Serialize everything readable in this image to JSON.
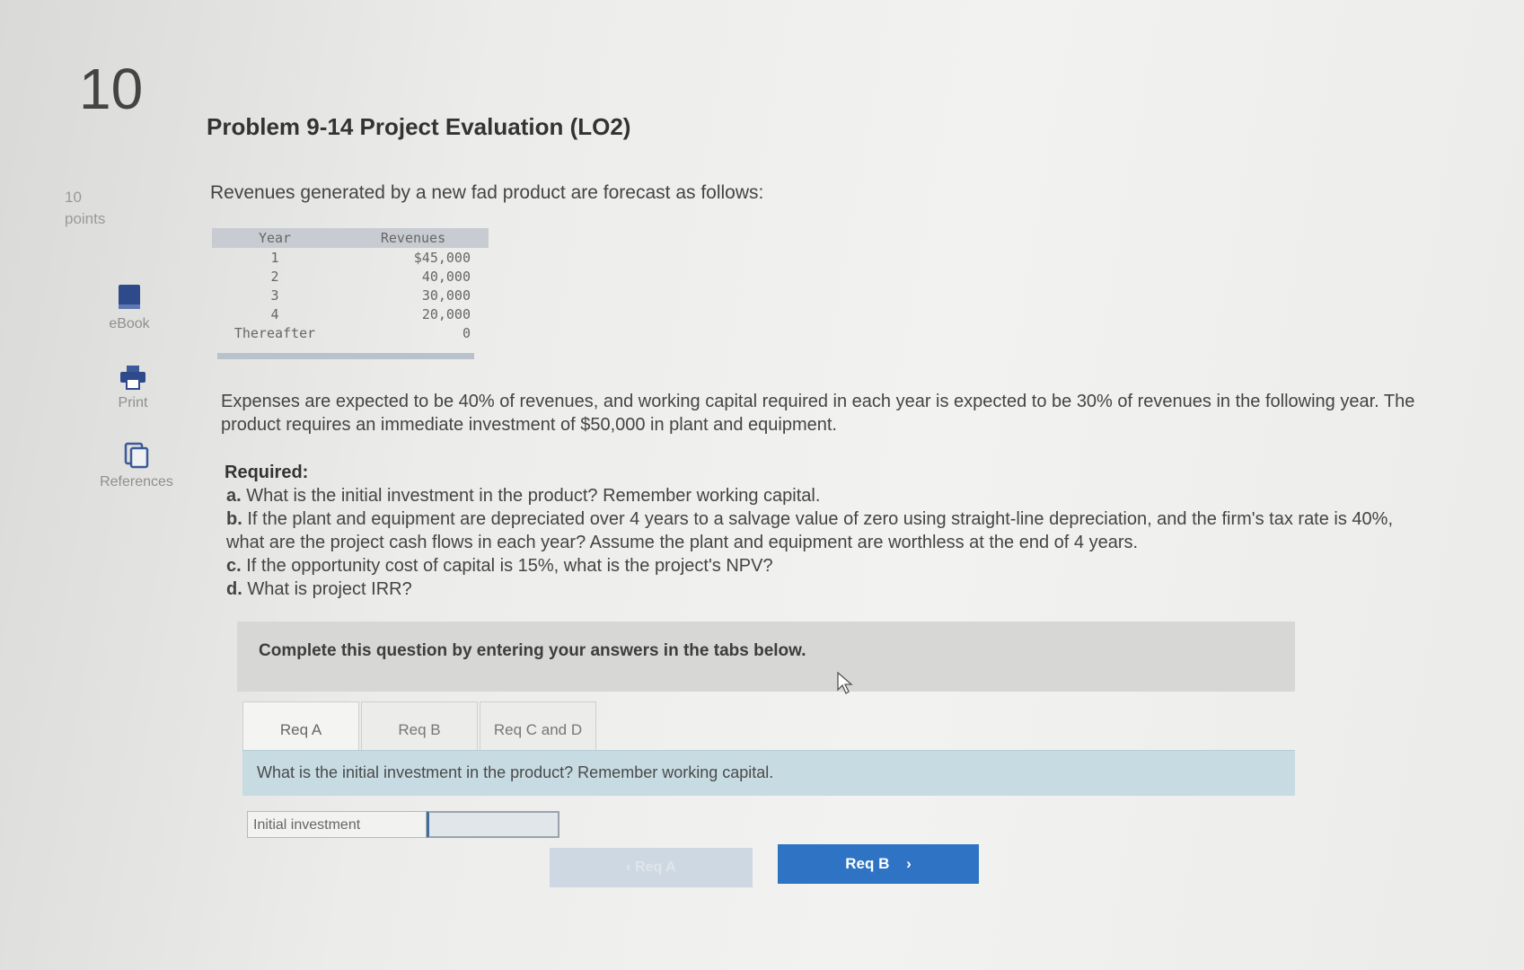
{
  "question": {
    "number": "10",
    "points_value": "10",
    "points_label": "points"
  },
  "tools": {
    "ebook": "eBook",
    "print": "Print",
    "references": "References"
  },
  "problem": {
    "title": "Problem 9-14 Project Evaluation (LO2)",
    "intro": "Revenues generated by a new fad product are forecast as follows:",
    "table": {
      "headers": [
        "Year",
        "Revenues"
      ],
      "rows": [
        [
          "1",
          "$45,000"
        ],
        [
          "2",
          "40,000"
        ],
        [
          "3",
          "30,000"
        ],
        [
          "4",
          "20,000"
        ],
        [
          "Thereafter",
          "0"
        ]
      ]
    },
    "paragraph": "Expenses are expected to be 40% of revenues, and working capital required in each year is expected to be 30% of revenues in the following year. The product requires an immediate investment of $50,000 in plant and equipment.",
    "required": {
      "heading": "Required:",
      "items": [
        {
          "letter": "a.",
          "text": "What is the initial investment in the product? Remember working capital."
        },
        {
          "letter": "b.",
          "text": "If the plant and equipment are depreciated over 4 years to a salvage value of zero using straight-line depreciation, and the firm's tax rate is 40%, what are the project cash flows in each year? Assume the plant  and equipment are worthless at the end of 4 years."
        },
        {
          "letter": "c.",
          "text": "If the opportunity cost of capital is 15%, what is the project's NPV?"
        },
        {
          "letter": "d.",
          "text": "What is project IRR?"
        }
      ]
    }
  },
  "instructions": "Complete this question by entering your answers in the tabs below.",
  "tabs": [
    {
      "label": "Req A",
      "active": true
    },
    {
      "label": "Req B",
      "active": false
    },
    {
      "label": "Req C and D",
      "active": false
    }
  ],
  "active_question": "What is the initial investment in the product? Remember working capital.",
  "answer": {
    "label": "Initial investment",
    "value": ""
  },
  "navigation": {
    "prev_label": "Req A",
    "next_label": "Req B"
  },
  "colors": {
    "next_button": "#2f74c4",
    "question_bar": "#c7dbe3",
    "table_header": "#c8ccd2"
  }
}
